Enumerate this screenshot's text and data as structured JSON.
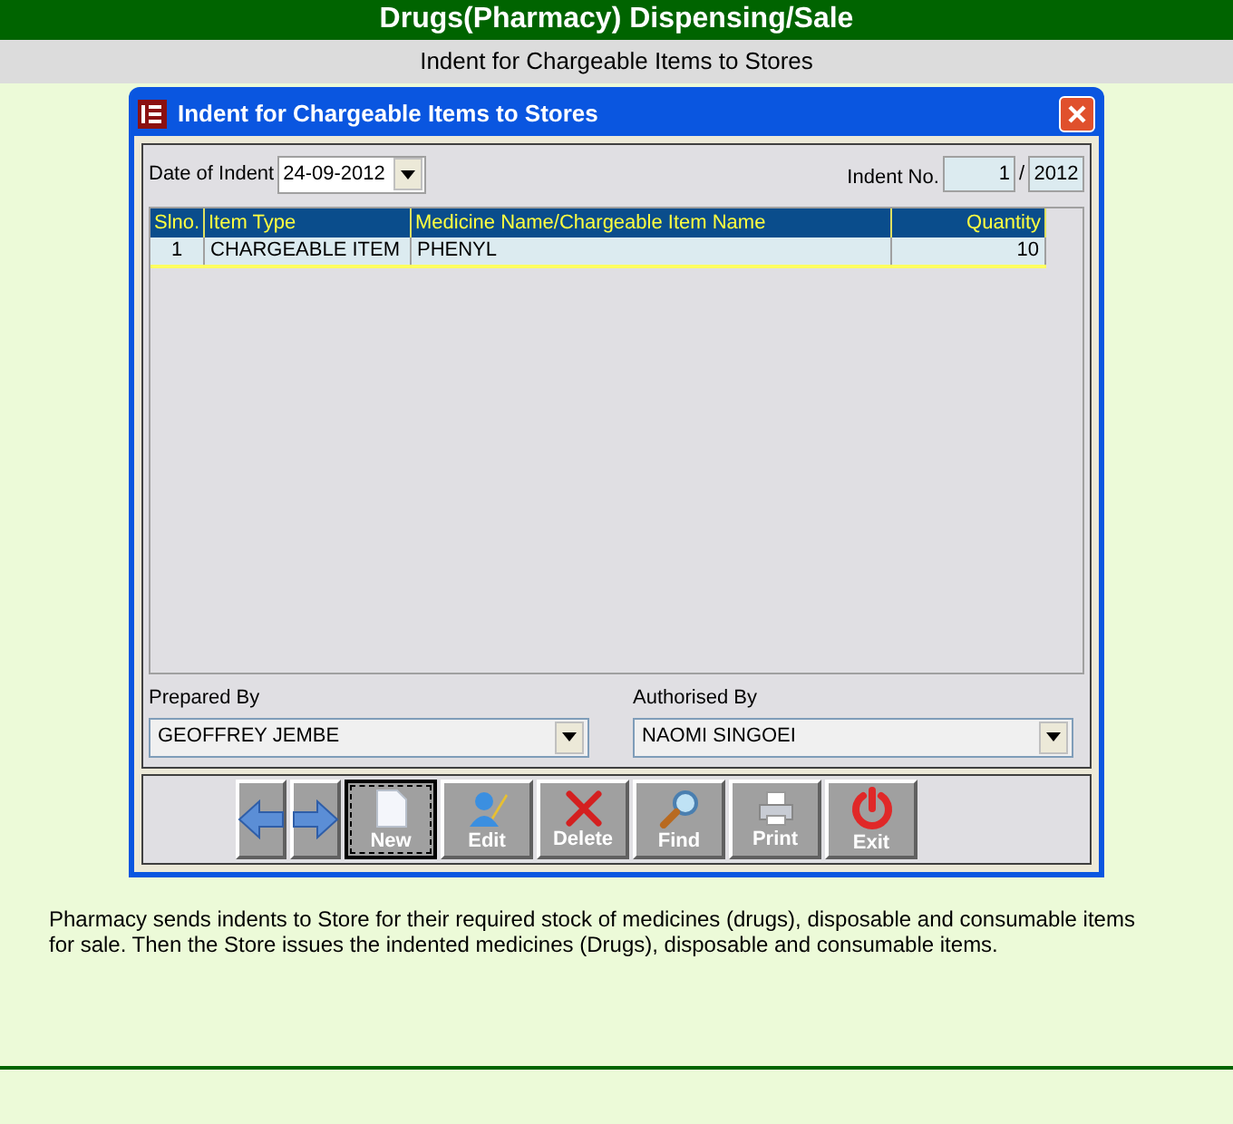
{
  "header": {
    "title": "Drugs(Pharmacy) Dispensing/Sale",
    "subtitle": "Indent for Chargeable Items to Stores"
  },
  "dialog": {
    "title": "Indent for Chargeable Items to Stores",
    "date_label": "Date of Indent",
    "date_value": "24-09-2012",
    "indent_label": "Indent No.",
    "indent_number": "1",
    "indent_separator": "/",
    "indent_year": "2012",
    "table": {
      "columns": [
        "Slno.",
        "Item Type",
        "Medicine Name/Chargeable Item Name",
        "Quantity"
      ],
      "rows": [
        {
          "cells": [
            "1",
            "CHARGEABLE ITEM",
            "PHENYL",
            "10"
          ],
          "selected": true
        }
      ]
    },
    "prepared_label": "Prepared By",
    "prepared_value": "GEOFFREY JEMBE",
    "authorised_label": "Authorised By",
    "authorised_value": "NAOMI SINGOEI",
    "toolbar": [
      {
        "kind": "back",
        "selected": false
      },
      {
        "kind": "forward",
        "selected": false
      },
      {
        "kind": "new",
        "label": "New",
        "selected": true
      },
      {
        "kind": "edit",
        "label": "Edit",
        "selected": false
      },
      {
        "kind": "delete",
        "label": "Delete",
        "selected": false
      },
      {
        "kind": "find",
        "label": "Find",
        "selected": false
      },
      {
        "kind": "print",
        "label": "Print",
        "selected": false
      },
      {
        "kind": "exit",
        "label": "Exit",
        "selected": false
      }
    ]
  },
  "description": "Pharmacy sends indents to Store for their required stock of medicines (drugs), disposable and consumable items for sale. Then the Store issues the indented medicines (Drugs), disposable and consumable items."
}
